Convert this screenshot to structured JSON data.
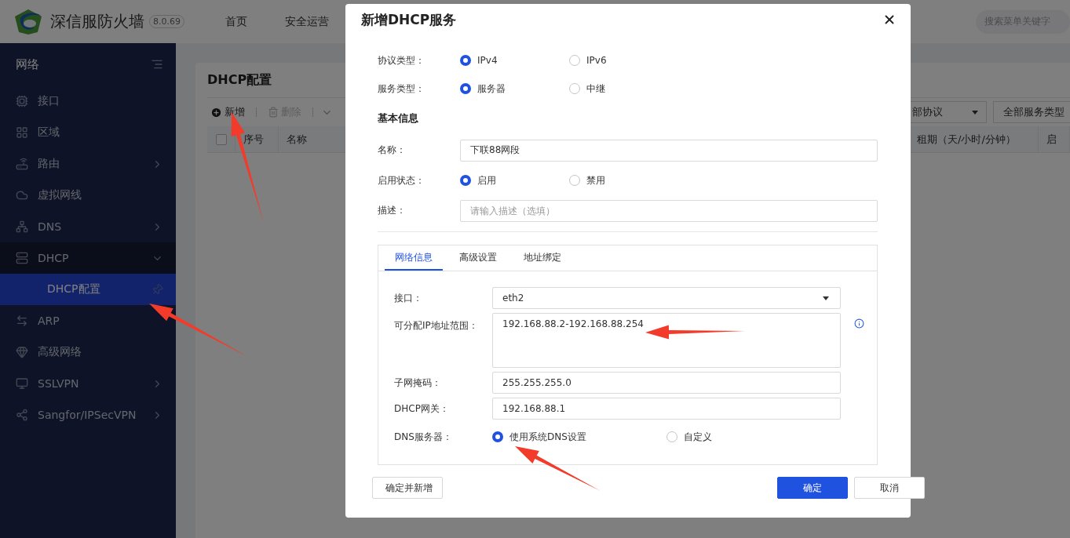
{
  "header": {
    "product": "深信服防火墙",
    "version": "8.0.69",
    "nav": [
      "首页",
      "安全运营"
    ],
    "search_placeholder": "搜索菜单关键字"
  },
  "sidebar": {
    "title": "网络",
    "items": [
      {
        "label": "接口",
        "kind": "link",
        "selected": false
      },
      {
        "label": "区域",
        "kind": "link",
        "selected": false
      },
      {
        "label": "路由",
        "kind": "group",
        "expanded": false,
        "selected": false
      },
      {
        "label": "虚拟网线",
        "kind": "link",
        "selected": false
      },
      {
        "label": "DNS",
        "kind": "group",
        "expanded": false,
        "selected": false
      },
      {
        "label": "DHCP",
        "kind": "group",
        "expanded": true,
        "selected": false,
        "children": [
          {
            "label": "DHCP配置",
            "selected": true
          }
        ]
      },
      {
        "label": "ARP",
        "kind": "link",
        "selected": false
      },
      {
        "label": "高级网络",
        "kind": "link",
        "selected": false
      },
      {
        "label": "SSLVPN",
        "kind": "group",
        "expanded": false,
        "selected": false
      },
      {
        "label": "Sangfor/IPSecVPN",
        "kind": "group",
        "expanded": false,
        "selected": false
      }
    ]
  },
  "page": {
    "title": "DHCP配置",
    "toolbar": [
      {
        "label": "新增",
        "disabled": false
      },
      {
        "label": "删除",
        "disabled": true
      }
    ],
    "filters": [
      {
        "label": "部协议",
        "kind": "dropdown"
      },
      {
        "label": "全部服务类型",
        "kind": "button"
      }
    ],
    "select_all": {
      "checked": false
    },
    "columns": [
      "序号",
      "名称",
      "租期（天/小时/分钟）",
      "启"
    ]
  },
  "dialog": {
    "title": "新增DHCP服务",
    "fields": [
      {
        "kind": "radio",
        "label": "协议类型：",
        "options": [
          {
            "label": "IPv4",
            "selected": true
          },
          {
            "label": "IPv6",
            "selected": false
          }
        ]
      },
      {
        "kind": "radio",
        "label": "服务类型：",
        "options": [
          {
            "label": "服务器",
            "selected": true
          },
          {
            "label": "中继",
            "selected": false
          }
        ]
      },
      {
        "kind": "heading",
        "label": "基本信息"
      },
      {
        "kind": "input",
        "label": "名称：",
        "value": "下联88网段"
      },
      {
        "kind": "radio",
        "label": "启用状态：",
        "options": [
          {
            "label": "启用",
            "selected": true
          },
          {
            "label": "禁用",
            "selected": false
          }
        ]
      },
      {
        "kind": "input",
        "label": "描述：",
        "placeholder": "请输入描述（选填）"
      }
    ],
    "tabs": [
      {
        "label": "网络信息",
        "selected": true
      },
      {
        "label": "高级设置",
        "selected": false
      },
      {
        "label": "地址绑定",
        "selected": false
      }
    ],
    "tab_fields": [
      {
        "kind": "select",
        "label": "接口：",
        "value": "eth2"
      },
      {
        "kind": "textarea",
        "label": "可分配IP地址范围：",
        "value": "192.168.88.2-192.168.88.254"
      },
      {
        "kind": "input",
        "label": "子网掩码：",
        "value": "255.255.255.0"
      },
      {
        "kind": "input",
        "label": "DHCP网关：",
        "value": "192.168.88.1"
      },
      {
        "kind": "radio",
        "label": "DNS服务器：",
        "options": [
          {
            "label": "使用系统DNS设置",
            "selected": true
          },
          {
            "label": "自定义",
            "selected": false
          }
        ]
      }
    ],
    "buttons": [
      {
        "label": "确定并新增",
        "kind": "secondary"
      },
      {
        "label": "确定",
        "kind": "primary"
      },
      {
        "label": "取消",
        "kind": "secondary"
      }
    ]
  }
}
